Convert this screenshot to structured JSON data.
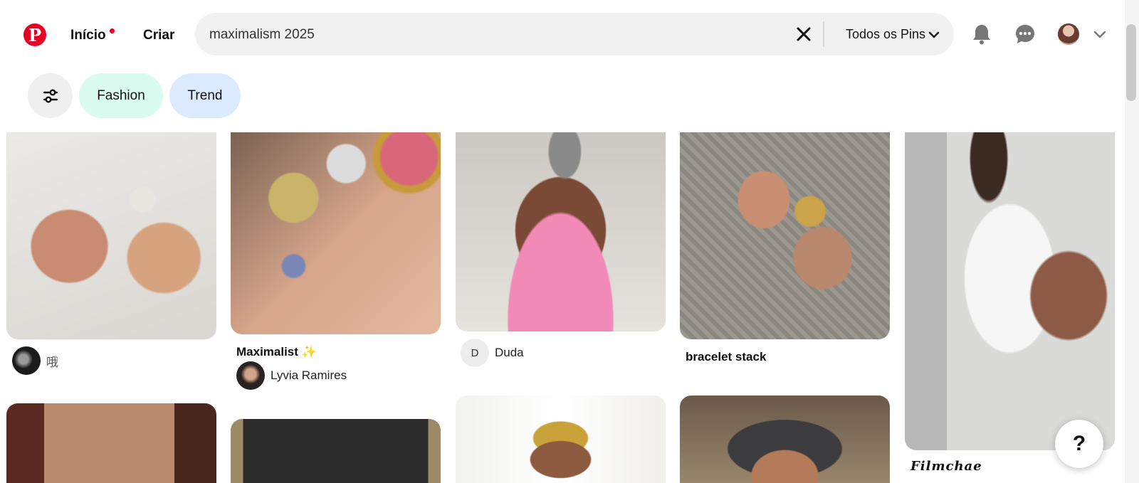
{
  "header": {
    "logo_letter": "P",
    "nav_home": "Início",
    "nav_create": "Criar",
    "search_value": "maximalism 2025",
    "search_scope": "Todos os Pins",
    "icons": [
      "pinterest-logo",
      "close-icon",
      "chevron-down-icon",
      "bell-icon",
      "chat-icon",
      "avatar",
      "chevron-down-icon"
    ]
  },
  "filters": {
    "chips": [
      "Fashion",
      "Trend"
    ],
    "chip_colors": [
      "#d9fbf0",
      "#dbeafe"
    ]
  },
  "pins": [
    {
      "user": "哦",
      "avatar_letter": ""
    },
    {
      "title": "Maximalist ✨",
      "user": "Lyvia Ramires"
    },
    {
      "user": "Duda",
      "avatar_letter": "D"
    },
    {
      "title": "bracelet stack"
    },
    {
      "title": "𝑭𝒊𝒍𝒎𝒄𝒉𝒂𝒆"
    }
  ],
  "help_label": "?",
  "colors": {
    "brand": "#e60023",
    "search_bg": "#f1f1f1"
  }
}
